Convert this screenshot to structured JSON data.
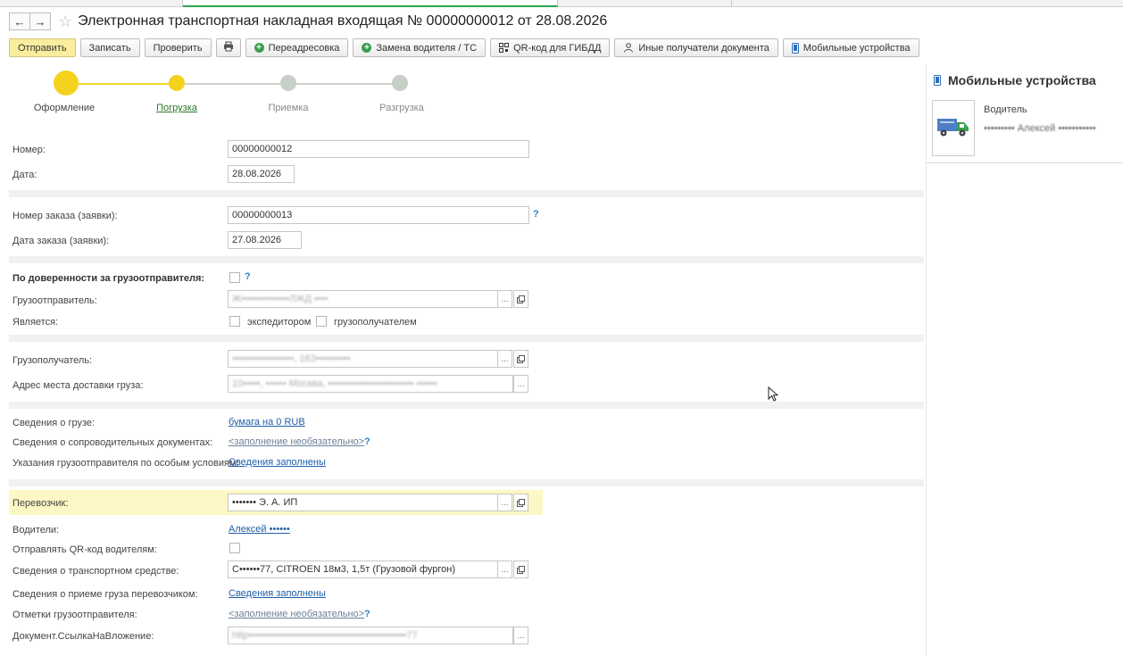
{
  "window": {
    "title": "Электронная транспортная накладная входящая № 00000000012 от 28.08.2026",
    "back_icon": "arrow-left-icon",
    "forward_icon": "arrow-right-icon",
    "favorite_icon": "star-icon"
  },
  "toolbar": {
    "send": "Отправить",
    "save": "Записать",
    "check": "Проверить",
    "print_icon": "printer-icon",
    "readdress": "Переадресовка",
    "replace_driver": "Замена водителя / ТС",
    "qr_gibdd": "QR-код для ГИБДД",
    "other_recipients": "Иные получатели документа",
    "mobile_devices": "Мобильные устройства"
  },
  "stages": {
    "items": [
      "Оформление",
      "Погрузка",
      "Приемка",
      "Разгрузка"
    ],
    "current": 1,
    "colors": {
      "done": "#f5d21e",
      "pending": "#c6d0c6"
    }
  },
  "form": {
    "number": {
      "label": "Номер:",
      "value": "00000000012"
    },
    "date": {
      "label": "Дата:",
      "value": "28.08.2026"
    },
    "order_number": {
      "label": "Номер заказа (заявки):",
      "value": "00000000013"
    },
    "order_date": {
      "label": "Дата заказа (заявки):",
      "value": "27.08.2026"
    },
    "by_power_of_attorney": {
      "label": "По доверенности за грузоотправителя:",
      "checked": false
    },
    "shipper": {
      "label": "Грузоотправитель:",
      "value": "Ж••••••••••••••ЛЖД ••••"
    },
    "is": {
      "label": "Является:",
      "forwarder": "экспедитором",
      "consignee": "грузополучателем"
    },
    "consignee": {
      "label": "Грузополучатель:",
      "value": "••••••••••••••••••, 163••••••••••"
    },
    "delivery_address": {
      "label": "Адрес места доставки груза:",
      "value": "10•••••, •••••• Москва, ••••••••••••••••••••••••• ••••••"
    },
    "cargo_info": {
      "label": "Сведения о грузе:",
      "value": "бумага на 0 RUB"
    },
    "accompanying_docs": {
      "label": "Сведения о сопроводительных документах:",
      "value": "<заполнение необязательно>"
    },
    "shipper_instructions": {
      "label": "Указания грузоотправителя по особым условиям:",
      "value": "Сведения заполнены"
    },
    "carrier": {
      "label": "Перевозчик:",
      "value": "••••••• Э. А. ИП"
    },
    "drivers": {
      "label": "Водители:",
      "value": "Алексей ••••••"
    },
    "send_qr": {
      "label": "Отправлять QR-код водителям:",
      "checked": false
    },
    "vehicle": {
      "label": "Сведения о транспортном средстве:",
      "value": "С••••••77, CITROEN  18м3, 1,5т (Грузовой фургон)"
    },
    "acceptance_info": {
      "label": "Сведения о приеме груза перевозчиком:",
      "value": "Сведения заполнены"
    },
    "shipper_marks": {
      "label": "Отметки грузоотправителя:",
      "value": "<заполнение необязательно>"
    },
    "attachment_link": {
      "label": "Документ.СсылкаНаВложение:",
      "value": "http••••••••••••••••••••••••••••••••••••••••••••••77"
    }
  },
  "help_mark": "?",
  "select_button": "...",
  "open_icon": "open-window-icon",
  "mobile_panel": {
    "title": "Мобильные устройства",
    "role": "Водитель",
    "name": "••••••••• Алексей •••••••••••",
    "device_icon": "phone-icon",
    "truck_icon": "truck-icon"
  }
}
